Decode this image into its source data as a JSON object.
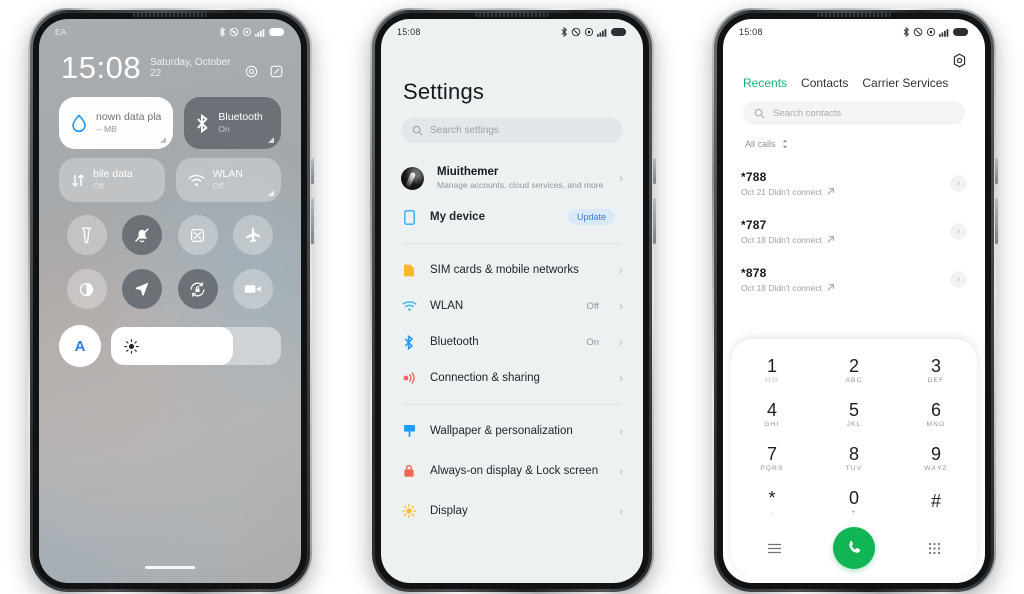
{
  "phone1": {
    "name": "control-center",
    "status": {
      "carrier": "EA",
      "icons": [
        "bluetooth-icon",
        "dnd-icon",
        "vpn-icon",
        "signal-icon",
        "battery-icon"
      ]
    },
    "clock": {
      "time": "15:08",
      "date": "Saturday, October 22",
      "icons": [
        "settings-icon",
        "edit-icon"
      ]
    },
    "big_tiles": [
      {
        "title": "nown data pla",
        "sub": "-- MB",
        "icon": "data-drop-icon",
        "state": "light"
      },
      {
        "title": "Bluetooth",
        "sub": "On",
        "icon": "bluetooth-icon",
        "state": "dark"
      }
    ],
    "small_tiles": [
      {
        "title": "bile data",
        "sub": "Off",
        "icon": "mobile-data-icon"
      },
      {
        "title": "WLAN",
        "sub": "Off",
        "icon": "wifi-icon"
      }
    ],
    "toggles": [
      {
        "icon": "flashlight-icon",
        "on": false
      },
      {
        "icon": "silent-mode-icon",
        "on": true
      },
      {
        "icon": "screenshot-icon",
        "on": false
      },
      {
        "icon": "airplane-mode-icon",
        "on": false
      },
      {
        "icon": "dark-mode-icon",
        "on": false
      },
      {
        "icon": "location-icon",
        "on": true
      },
      {
        "icon": "rotation-lock-icon",
        "on": true
      },
      {
        "icon": "screen-recorder-icon",
        "on": false
      }
    ],
    "brightness": {
      "auto_label": "A",
      "icon": "brightness-icon",
      "percent": 72
    }
  },
  "phone2": {
    "name": "settings",
    "status": {
      "time": "15:08"
    },
    "title": "Settings",
    "search": {
      "placeholder": "Search settings",
      "icon": "search-icon"
    },
    "account": {
      "name": "Miuithemer",
      "sub": "Manage accounts, cloud services, and more",
      "avatar": "user-avatar"
    },
    "device": {
      "label": "My device",
      "badge": "Update",
      "icon": "device-icon"
    },
    "group1": [
      {
        "label": "SIM cards & mobile networks",
        "value": "",
        "icon": "sim-card-icon",
        "color": "#f5b82e"
      },
      {
        "label": "WLAN",
        "value": "Off",
        "icon": "wifi-icon",
        "color": "#3bb3f0"
      },
      {
        "label": "Bluetooth",
        "value": "On",
        "icon": "bluetooth-icon",
        "color": "#2196f3"
      },
      {
        "label": "Connection & sharing",
        "value": "",
        "icon": "connection-sharing-icon",
        "color": "#f0675c"
      }
    ],
    "group2": [
      {
        "label": "Wallpaper & personalization",
        "value": "",
        "icon": "wallpaper-icon",
        "color": "#1f9df7"
      },
      {
        "label": "Always-on display & Lock screen",
        "value": "",
        "icon": "lock-icon",
        "color": "#f2654f"
      },
      {
        "label": "Display",
        "value": "",
        "icon": "display-icon",
        "color": "#f9bb2c"
      }
    ]
  },
  "phone3": {
    "name": "dialer",
    "status": {
      "time": "15:08"
    },
    "settings_icon": "gear-icon",
    "tabs": [
      {
        "label": "Recents",
        "active": true
      },
      {
        "label": "Contacts",
        "active": false
      },
      {
        "label": "Carrier Services",
        "active": false
      }
    ],
    "search": {
      "placeholder": "Search contacts",
      "icon": "search-icon"
    },
    "filter": {
      "label": "All calls",
      "icon": "sort-icon"
    },
    "calls": [
      {
        "number": "*788",
        "detail": "Oct 21 Didn't connect",
        "icon": "outgoing-call-icon"
      },
      {
        "number": "*787",
        "detail": "Oct 18 Didn't connect",
        "icon": "outgoing-call-icon"
      },
      {
        "number": "*878",
        "detail": "Oct 18 Didn't connect",
        "icon": "outgoing-call-icon"
      }
    ],
    "keypad": [
      {
        "digit": "1",
        "sub": ""
      },
      {
        "digit": "2",
        "sub": "ABC"
      },
      {
        "digit": "3",
        "sub": "DEF"
      },
      {
        "digit": "4",
        "sub": "GHI"
      },
      {
        "digit": "5",
        "sub": "JKL"
      },
      {
        "digit": "6",
        "sub": "MNO"
      },
      {
        "digit": "7",
        "sub": "PQRS"
      },
      {
        "digit": "8",
        "sub": "TUV"
      },
      {
        "digit": "9",
        "sub": "WXYZ"
      },
      {
        "digit": "*",
        "sub": ","
      },
      {
        "digit": "0",
        "sub": "+"
      },
      {
        "digit": "#",
        "sub": ""
      }
    ],
    "bottom": {
      "left_icon": "menu-icon",
      "call_icon": "call-icon",
      "right_icon": "keypad-icon",
      "call_color": "#11b553"
    }
  }
}
